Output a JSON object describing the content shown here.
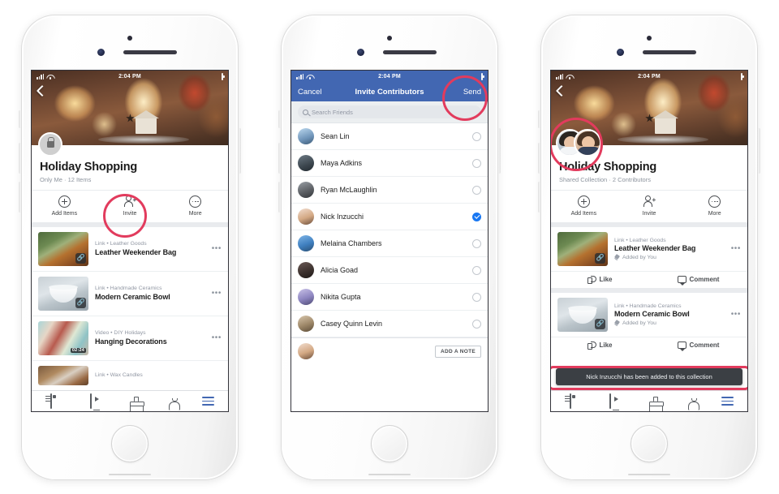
{
  "status_bar": {
    "time": "2:04 PM",
    "carrier_icon": "signal-bars-icon",
    "wifi_icon": "wifi-icon",
    "battery_icon": "battery-icon"
  },
  "phone1": {
    "name": "collection-private-screen",
    "back_icon": "back-chevron-icon",
    "privacy_icon": "lock-icon",
    "title": "Holiday Shopping",
    "subtitle": "Only Me · 12 Items",
    "actions": [
      {
        "label": "Add Items",
        "icon": "plus-circle-icon"
      },
      {
        "label": "Invite",
        "icon": "person-add-icon"
      },
      {
        "label": "More",
        "icon": "ellipsis-circle-icon"
      }
    ],
    "items": [
      {
        "meta": "Link • Leather Goods",
        "title": "Leather Weekender Bag",
        "badge": "link-icon",
        "thumb": "bag",
        "menu": "•••"
      },
      {
        "meta": "Link • Handmade Ceramics",
        "title": "Modern Ceramic Bowl",
        "badge": "link-icon",
        "thumb": "bowl",
        "menu": "•••"
      },
      {
        "meta": "Video • DIY Holidays",
        "title": "Hanging Decorations",
        "badge": "duration",
        "duration": "02:24",
        "thumb": "deco",
        "menu": "•••"
      },
      {
        "meta": "Link • Wax Candles",
        "title": "",
        "badge": "link-icon",
        "thumb": "candle",
        "menu": ""
      }
    ],
    "tabs": [
      {
        "icon": "news-feed-icon",
        "active": false
      },
      {
        "icon": "watch-icon",
        "active": false
      },
      {
        "icon": "marketplace-icon",
        "active": false
      },
      {
        "icon": "notifications-bell-icon",
        "active": false
      },
      {
        "icon": "hamburger-menu-icon",
        "active": true
      }
    ]
  },
  "phone2": {
    "name": "invite-contributors-screen",
    "nav": {
      "cancel": "Cancel",
      "title": "Invite Contributors",
      "send": "Send"
    },
    "search": {
      "placeholder": "Search Friends",
      "icon": "search-icon"
    },
    "friends": [
      {
        "name": "Sean Lin",
        "selected": false
      },
      {
        "name": "Maya Adkins",
        "selected": false
      },
      {
        "name": "Ryan McLaughlin",
        "selected": false
      },
      {
        "name": "Nick Inzucchi",
        "selected": true
      },
      {
        "name": "Melaina Chambers",
        "selected": false
      },
      {
        "name": "Alicia Goad",
        "selected": false
      },
      {
        "name": "Nikita Gupta",
        "selected": false
      },
      {
        "name": "Casey Quinn Levin",
        "selected": false
      }
    ],
    "note": {
      "label": "ADD A NOTE",
      "avatar": "user-avatar"
    }
  },
  "phone3": {
    "name": "shared-collection-screen",
    "back_icon": "back-chevron-icon",
    "contributors_icon": "contributor-avatars",
    "title": "Holiday Shopping",
    "subtitle": "Shared Collection · 2 Contributors",
    "actions": [
      {
        "label": "Add Items",
        "icon": "plus-circle-icon"
      },
      {
        "label": "Invite",
        "icon": "person-add-icon"
      },
      {
        "label": "More",
        "icon": "ellipsis-circle-icon"
      }
    ],
    "items": [
      {
        "meta": "Link • Leather Goods",
        "title": "Leather Weekender Bag",
        "added_by": "Added by You",
        "thumb": "bag",
        "menu": "•••"
      },
      {
        "meta": "Link • Handmade Ceramics",
        "title": "Modern Ceramic Bowl",
        "added_by": "Added by You",
        "thumb": "bowl",
        "menu": "•••"
      }
    ],
    "engagement": {
      "like": "Like",
      "comment": "Comment",
      "like_icon": "thumbs-up-icon",
      "comment_icon": "comment-bubble-icon"
    },
    "toast": "Nick Inzucchi has been added to this collection",
    "tabs": [
      {
        "icon": "news-feed-icon",
        "active": false
      },
      {
        "icon": "watch-icon",
        "active": false
      },
      {
        "icon": "marketplace-icon",
        "active": false
      },
      {
        "icon": "notifications-bell-icon",
        "active": false
      },
      {
        "icon": "hamburger-menu-icon",
        "active": true
      }
    ]
  },
  "colors": {
    "highlight": "#e23b5d",
    "facebook_blue": "#4267b2",
    "selected_blue": "#1877f2"
  }
}
